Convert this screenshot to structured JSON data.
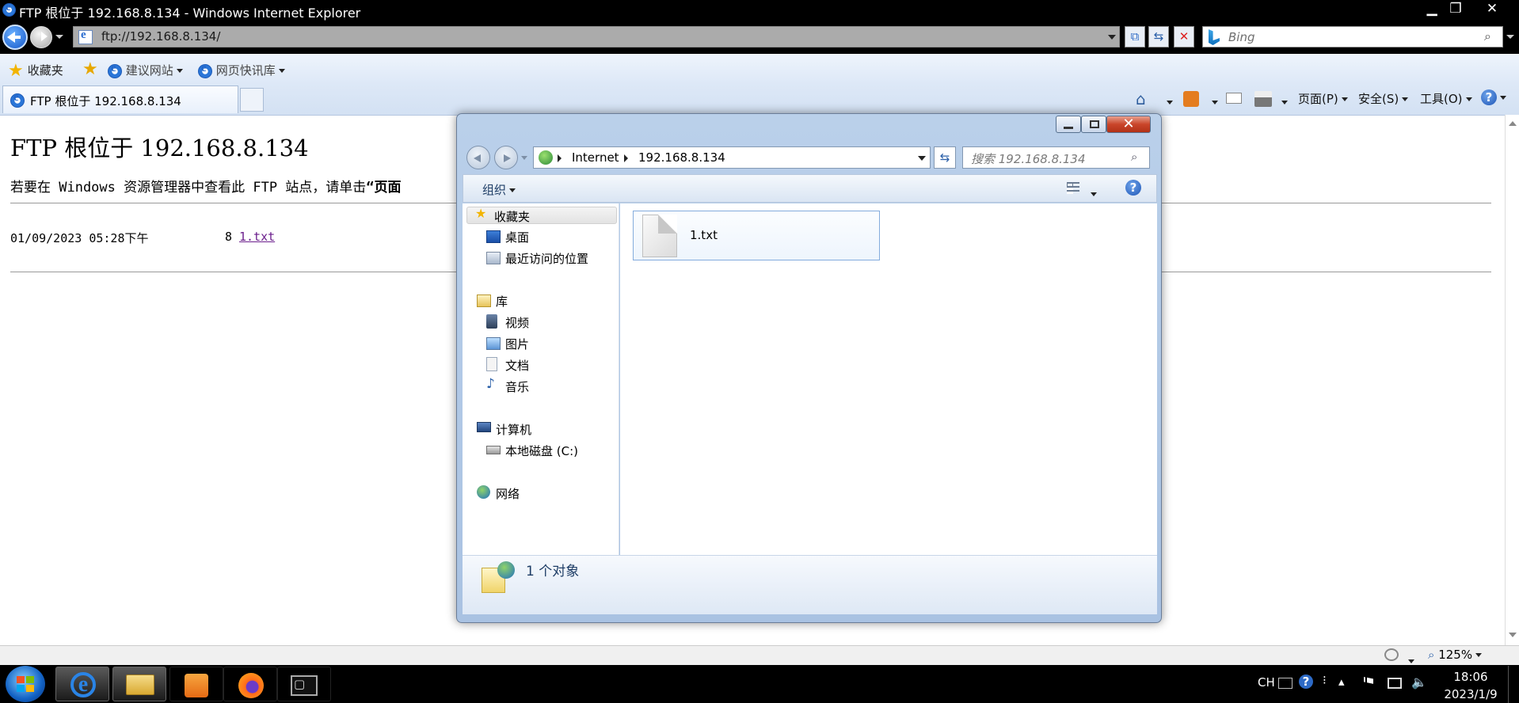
{
  "window": {
    "title": "FTP 根位于 192.168.8.134 - Windows Internet Explorer",
    "minimize": "▁",
    "maximize": "❐",
    "close": "✕"
  },
  "address_bar": {
    "url": "ftp://192.168.8.134/"
  },
  "search_bar": {
    "placeholder": "Bing"
  },
  "favorites_bar": {
    "favorites_label": "收藏夹",
    "items": [
      "建议网站",
      "网页快讯库"
    ]
  },
  "tab": {
    "label": "FTP 根位于 192.168.8.134"
  },
  "command_bar": {
    "page_label": "页面(P)",
    "safety_label": "安全(S)",
    "tools_label": "工具(O)"
  },
  "page": {
    "heading": "FTP 根位于 192.168.8.134",
    "note_prefix": "若要在 Windows 资源管理器中查看此 FTP 站点，请单击",
    "note_bold": "“页面",
    "listing": [
      {
        "date": "01/09/2023 05:28下午",
        "size": "8",
        "name": "1.txt"
      }
    ]
  },
  "status_bar": {
    "zoom": "125%"
  },
  "explorer": {
    "breadcrumb": [
      "Internet",
      "192.168.8.134"
    ],
    "search_placeholder": "搜索 192.168.8.134",
    "organize_label": "组织",
    "nav": {
      "favorites": {
        "label": "收藏夹",
        "items": [
          "桌面",
          "最近访问的位置"
        ]
      },
      "libraries": {
        "label": "库",
        "items": [
          "视频",
          "图片",
          "文档",
          "音乐"
        ]
      },
      "computer": {
        "label": "计算机",
        "items": [
          "本地磁盘 (C:)"
        ]
      },
      "network": {
        "label": "网络"
      }
    },
    "files": [
      {
        "name": "1.txt"
      }
    ],
    "status_text": "1 个对象"
  },
  "taskbar": {
    "tray": {
      "lang": "CH",
      "time": "18:06",
      "date": "2023/1/9"
    }
  },
  "colors": {
    "accent": "#1456c8",
    "visited_link": "#6b1e8c",
    "explorer_frame": "#a9c2e2"
  }
}
